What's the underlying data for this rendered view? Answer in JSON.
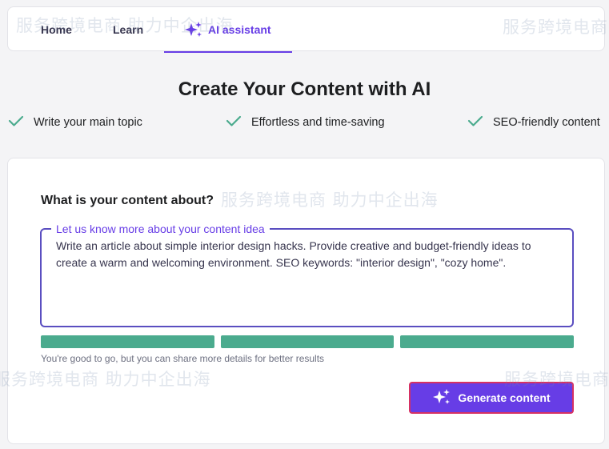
{
  "nav": {
    "tabs": [
      {
        "label": "Home"
      },
      {
        "label": "Learn"
      },
      {
        "label": "AI assistant",
        "icon": "sparkles-icon",
        "active": true
      }
    ]
  },
  "title": "Create Your Content with AI",
  "features": [
    {
      "icon": "check-icon",
      "text": "Write your main topic"
    },
    {
      "icon": "check-icon",
      "text": "Effortless and time-saving"
    },
    {
      "icon": "check-icon",
      "text": "SEO-friendly content"
    }
  ],
  "form": {
    "question": "What is your content about?",
    "textarea": {
      "legend": "Let us know more about your content idea",
      "value": "Write an article about simple interior design hacks. Provide creative and budget-friendly ideas to create a warm and welcoming environment. SEO keywords: \"interior design\", \"cozy home\"."
    },
    "progress": {
      "filled_segments": 3,
      "total_segments": 3
    },
    "hint": "You're good to go, but you can share more details for better results",
    "generate_label": "Generate content",
    "generate_icon": "sparkles-icon"
  },
  "watermark": {
    "text": "服务跨境电商 助力中企出海"
  },
  "colors": {
    "accent": "#673de6",
    "success": "#4bab8e",
    "button_border": "#d63163"
  }
}
